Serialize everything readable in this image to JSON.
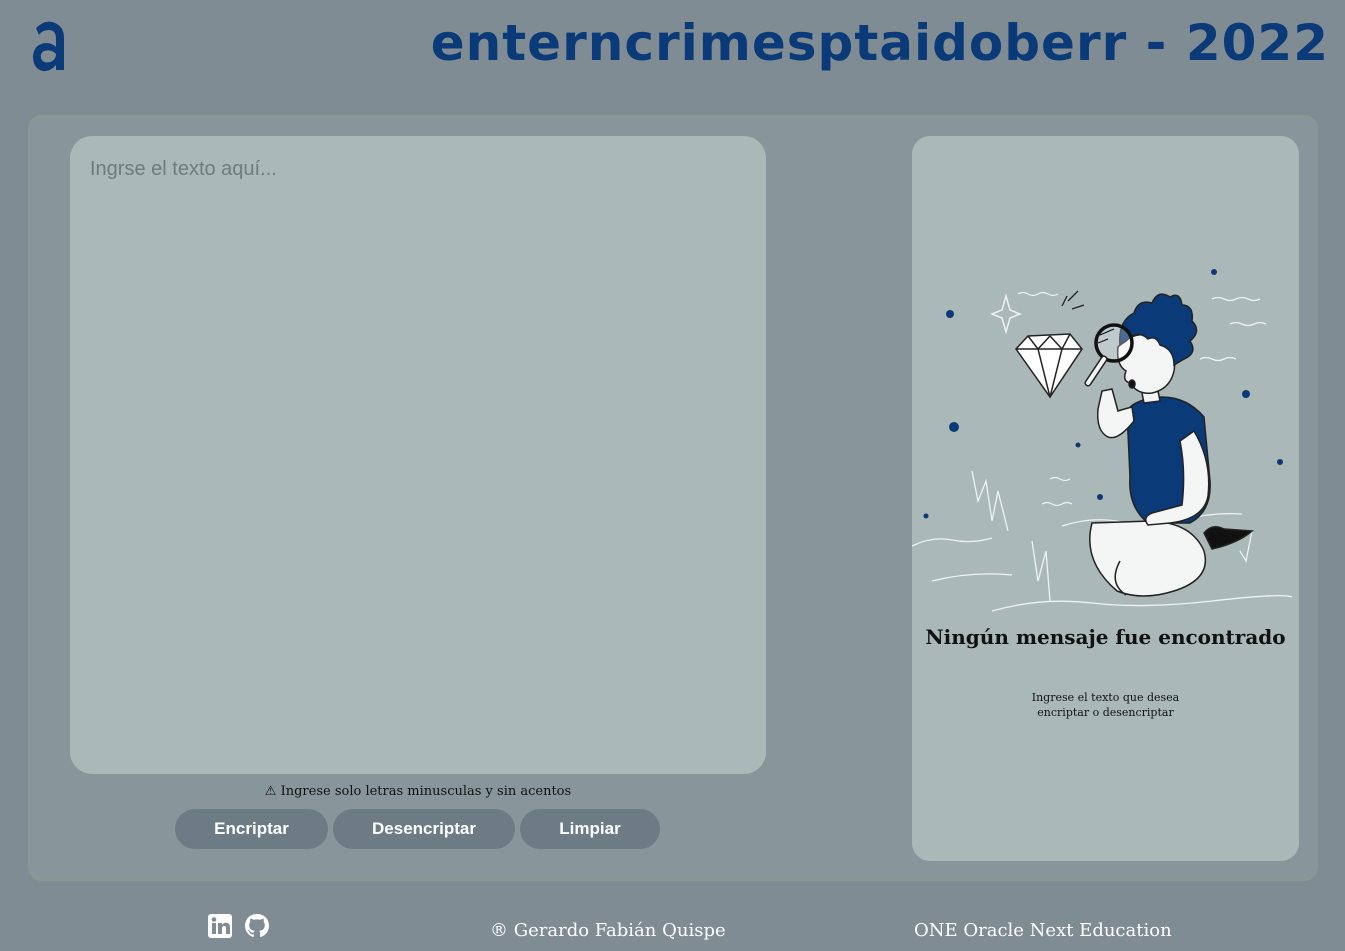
{
  "header": {
    "logo_icon": "alura-a-logo-icon",
    "title": "enterncrimesptaidoberr - 2022"
  },
  "colors": {
    "background": "#808c94",
    "accent": "#0a3a78",
    "panel": "#abb8b8",
    "button": "#6c7b84"
  },
  "input": {
    "placeholder": "Ingrse el texto aquí...",
    "value": ""
  },
  "warning": {
    "icon": "warning-icon",
    "text": "Ingrese solo letras minusculas y sin acentos"
  },
  "buttons": {
    "encrypt": "Encriptar",
    "decrypt": "Desencriptar",
    "clear": "Limpiar"
  },
  "output": {
    "illustration": "person-with-magnifying-glass-and-diamond-illustration",
    "title": "Ningún mensaje fue encontrado",
    "subtitle": "Ingrese el texto que desea encriptar o desencriptar"
  },
  "footer": {
    "social": [
      "linkedin-icon",
      "github-icon"
    ],
    "credit": "® Gerardo Fabián Quispe",
    "program": "ONE Oracle Next Education"
  }
}
